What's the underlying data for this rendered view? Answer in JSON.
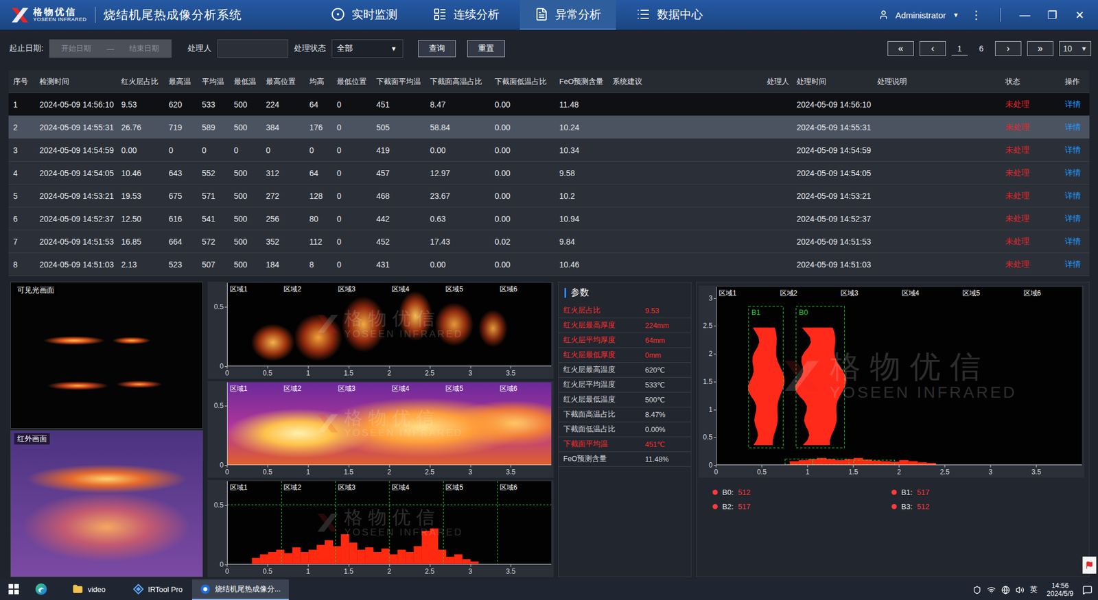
{
  "header": {
    "logo": {
      "cn": "格物优信",
      "en": "YOSEEN INFRARED"
    },
    "title": "烧结机尾热成像分析系统",
    "tabs": [
      {
        "label": "实时监测",
        "selected": false
      },
      {
        "label": "连续分析",
        "selected": false
      },
      {
        "label": "异常分析",
        "selected": true
      },
      {
        "label": "数据中心",
        "selected": false
      }
    ],
    "user": "Administrator",
    "user_caret": "▼",
    "more": "⋮",
    "window_controls": [
      "—",
      "❐",
      "✕"
    ]
  },
  "filters": {
    "date_label": "起止日期:",
    "start_placeholder": "开始日期",
    "separator": "—",
    "end_placeholder": "结束日期",
    "handler_label": "处理人",
    "handler_value": "",
    "status_label": "处理状态",
    "status_value": "全部",
    "status_caret": "▼",
    "buttons": [
      "查询",
      "重置"
    ]
  },
  "pagination": {
    "first": "«",
    "prev": "‹",
    "current": "1",
    "total": "6",
    "next": "›",
    "last": "»",
    "page_size": "10",
    "page_size_caret": "▼"
  },
  "table": {
    "columns": [
      "序号",
      "检测时间",
      "红火层占比",
      "最高温",
      "平均温",
      "最低温",
      "最高位置",
      "均高",
      "最低位置",
      "下截面平均温",
      "下截面高温占比",
      "下截面低温占比",
      "FeO预测含量",
      "系统建议",
      "处理人",
      "处理时间",
      "处理说明",
      "状态",
      "操作"
    ],
    "rows": [
      {
        "selected": true,
        "hovered": false,
        "cells": [
          "1",
          "2024-05-09 14:56:10",
          "9.53",
          "620",
          "533",
          "500",
          "224",
          "64",
          "0",
          "451",
          "8.47",
          "0.00",
          "11.48",
          "",
          "",
          "2024-05-09 14:56:10",
          "",
          "未处理",
          "详情"
        ]
      },
      {
        "selected": false,
        "hovered": true,
        "cells": [
          "2",
          "2024-05-09 14:55:31",
          "26.76",
          "719",
          "589",
          "500",
          "384",
          "176",
          "0",
          "505",
          "58.84",
          "0.00",
          "10.24",
          "",
          "",
          "2024-05-09 14:55:31",
          "",
          "未处理",
          "详情"
        ]
      },
      {
        "selected": false,
        "hovered": false,
        "cells": [
          "3",
          "2024-05-09 14:54:59",
          "0.00",
          "0",
          "0",
          "0",
          "0",
          "0",
          "0",
          "419",
          "0.00",
          "0.00",
          "10.34",
          "",
          "",
          "2024-05-09 14:54:59",
          "",
          "未处理",
          "详情"
        ]
      },
      {
        "selected": false,
        "hovered": false,
        "cells": [
          "4",
          "2024-05-09 14:54:05",
          "10.46",
          "643",
          "552",
          "500",
          "312",
          "64",
          "0",
          "457",
          "12.97",
          "0.00",
          "9.58",
          "",
          "",
          "2024-05-09 14:54:05",
          "",
          "未处理",
          "详情"
        ]
      },
      {
        "selected": false,
        "hovered": false,
        "cells": [
          "5",
          "2024-05-09 14:53:21",
          "19.53",
          "675",
          "571",
          "500",
          "272",
          "128",
          "0",
          "468",
          "23.67",
          "0.00",
          "10.2",
          "",
          "",
          "2024-05-09 14:53:21",
          "",
          "未处理",
          "详情"
        ]
      },
      {
        "selected": false,
        "hovered": false,
        "cells": [
          "6",
          "2024-05-09 14:52:37",
          "12.50",
          "616",
          "541",
          "500",
          "256",
          "80",
          "0",
          "442",
          "0.63",
          "0.00",
          "10.94",
          "",
          "",
          "2024-05-09 14:52:37",
          "",
          "未处理",
          "详情"
        ]
      },
      {
        "selected": false,
        "hovered": false,
        "cells": [
          "7",
          "2024-05-09 14:51:53",
          "16.85",
          "664",
          "572",
          "500",
          "352",
          "112",
          "0",
          "452",
          "17.43",
          "0.02",
          "9.84",
          "",
          "",
          "2024-05-09 14:51:53",
          "",
          "未处理",
          "详情"
        ]
      },
      {
        "selected": false,
        "hovered": false,
        "cells": [
          "8",
          "2024-05-09 14:51:03",
          "2.13",
          "523",
          "507",
          "500",
          "184",
          "8",
          "0",
          "431",
          "0.00",
          "0.00",
          "10.46",
          "",
          "",
          "2024-05-09 14:51:03",
          "",
          "未处理",
          "详情"
        ]
      }
    ]
  },
  "visible_view": {
    "title": "可见光画面"
  },
  "infrared_view": {
    "title": "红外画面"
  },
  "strip_charts": {
    "zones": [
      "区域1",
      "区域2",
      "区域3",
      "区域4",
      "区域5",
      "区域6"
    ],
    "x_ticks": [
      "0",
      "0.5",
      "1",
      "1.5",
      "2",
      "2.5",
      "3",
      "3.5"
    ],
    "y_ticks": [
      "0",
      "0.5"
    ],
    "panels": [
      {
        "kind": "flame"
      },
      {
        "kind": "thermal"
      },
      {
        "kind": "profile",
        "threshold": 0.5,
        "values": [
          0,
          0,
          0,
          0.05,
          0.08,
          0.1,
          0.12,
          0.09,
          0.14,
          0.1,
          0.12,
          0.16,
          0.2,
          0.15,
          0.25,
          0.18,
          0.12,
          0.14,
          0.1,
          0.13,
          0.08,
          0.12,
          0.1,
          0.15,
          0.28,
          0.3,
          0.12,
          0.06,
          0.08,
          0.04,
          0.02,
          0,
          0,
          0,
          0,
          0,
          0,
          0,
          0,
          0
        ]
      }
    ]
  },
  "params": {
    "title": "参数",
    "rows": [
      {
        "label": "红火层占比",
        "value": "9.53",
        "color": "#ff3030"
      },
      {
        "label": "红火层最高厚度",
        "value": "224mm",
        "color": "#ff3030"
      },
      {
        "label": "红火层平均厚度",
        "value": "64mm",
        "color": "#ff3030"
      },
      {
        "label": "红火层最低厚度",
        "value": "0mm",
        "color": "#ff3030"
      },
      {
        "label": "红火层最高温度",
        "value": "620℃",
        "color": "#d6d9de"
      },
      {
        "label": "红火层平均温度",
        "value": "533℃",
        "color": "#d6d9de"
      },
      {
        "label": "红火层最低温度",
        "value": "500℃",
        "color": "#d6d9de"
      },
      {
        "label": "下截面高温占比",
        "value": "8.47%",
        "color": "#d6d9de"
      },
      {
        "label": "下截面低温占比",
        "value": "0.00%",
        "color": "#d6d9de"
      },
      {
        "label": "下截面平均温",
        "value": "451℃",
        "color": "#ff3030"
      },
      {
        "label": "FeO预测含量",
        "value": "11.48%",
        "color": "#d6d9de"
      }
    ]
  },
  "region_chart": {
    "zones": [
      "区域1",
      "区域2",
      "区域3",
      "区域4",
      "区域5",
      "区域6"
    ],
    "x_ticks": [
      "0",
      "0.5",
      "1",
      "1.5",
      "2",
      "2.5",
      "3",
      "3.5"
    ],
    "y_ticks": [
      "0",
      "0.5",
      "1",
      "1.5",
      "2",
      "2.5",
      "3"
    ],
    "boxes": [
      {
        "label": "B1",
        "x0": 0.35,
        "x1": 0.73,
        "y0": 0.3,
        "y1": 2.85
      },
      {
        "label": "B0",
        "x0": 0.87,
        "x1": 1.4,
        "y0": 0.3,
        "y1": 2.85
      },
      {
        "label": "",
        "x0": 0.75,
        "x1": 1.05,
        "y0": 0,
        "y1": 0.1
      },
      {
        "label": "",
        "x0": 1.05,
        "x1": 1.45,
        "y0": 0,
        "y1": 0.1
      },
      {
        "label": "",
        "x0": 1.5,
        "x1": 1.95,
        "y0": 0,
        "y1": 0.08
      }
    ],
    "bottom_profile": [
      0,
      0,
      0,
      0,
      0,
      0,
      0,
      0,
      0.06,
      0.08,
      0.1,
      0.12,
      0.1,
      0.08,
      0.1,
      0.12,
      0.09,
      0.07,
      0.06,
      0.05,
      0.08,
      0.06,
      0.04,
      0.03,
      0,
      0,
      0,
      0,
      0,
      0,
      0,
      0,
      0,
      0,
      0,
      0,
      0,
      0,
      0,
      0
    ],
    "legend": [
      {
        "name": "B0:",
        "value": "512"
      },
      {
        "name": "B1:",
        "value": "517"
      },
      {
        "name": "B2:",
        "value": "517"
      },
      {
        "name": "B3:",
        "value": "512"
      }
    ]
  },
  "watermark": {
    "cn": "格物优信",
    "en": "YOSEEN INFRARED"
  },
  "taskbar": {
    "apps": [
      {
        "kind": "start",
        "label": "",
        "selected": false
      },
      {
        "kind": "browser",
        "label": "",
        "selected": false
      },
      {
        "kind": "folder",
        "label": "video",
        "selected": false
      },
      {
        "kind": "tool",
        "label": "IRTool Pro",
        "selected": false
      },
      {
        "kind": "app",
        "label": "烧结机尾热成像分...",
        "selected": true
      }
    ],
    "ime": "英",
    "time": "14:56",
    "date": "2024/5/9"
  }
}
